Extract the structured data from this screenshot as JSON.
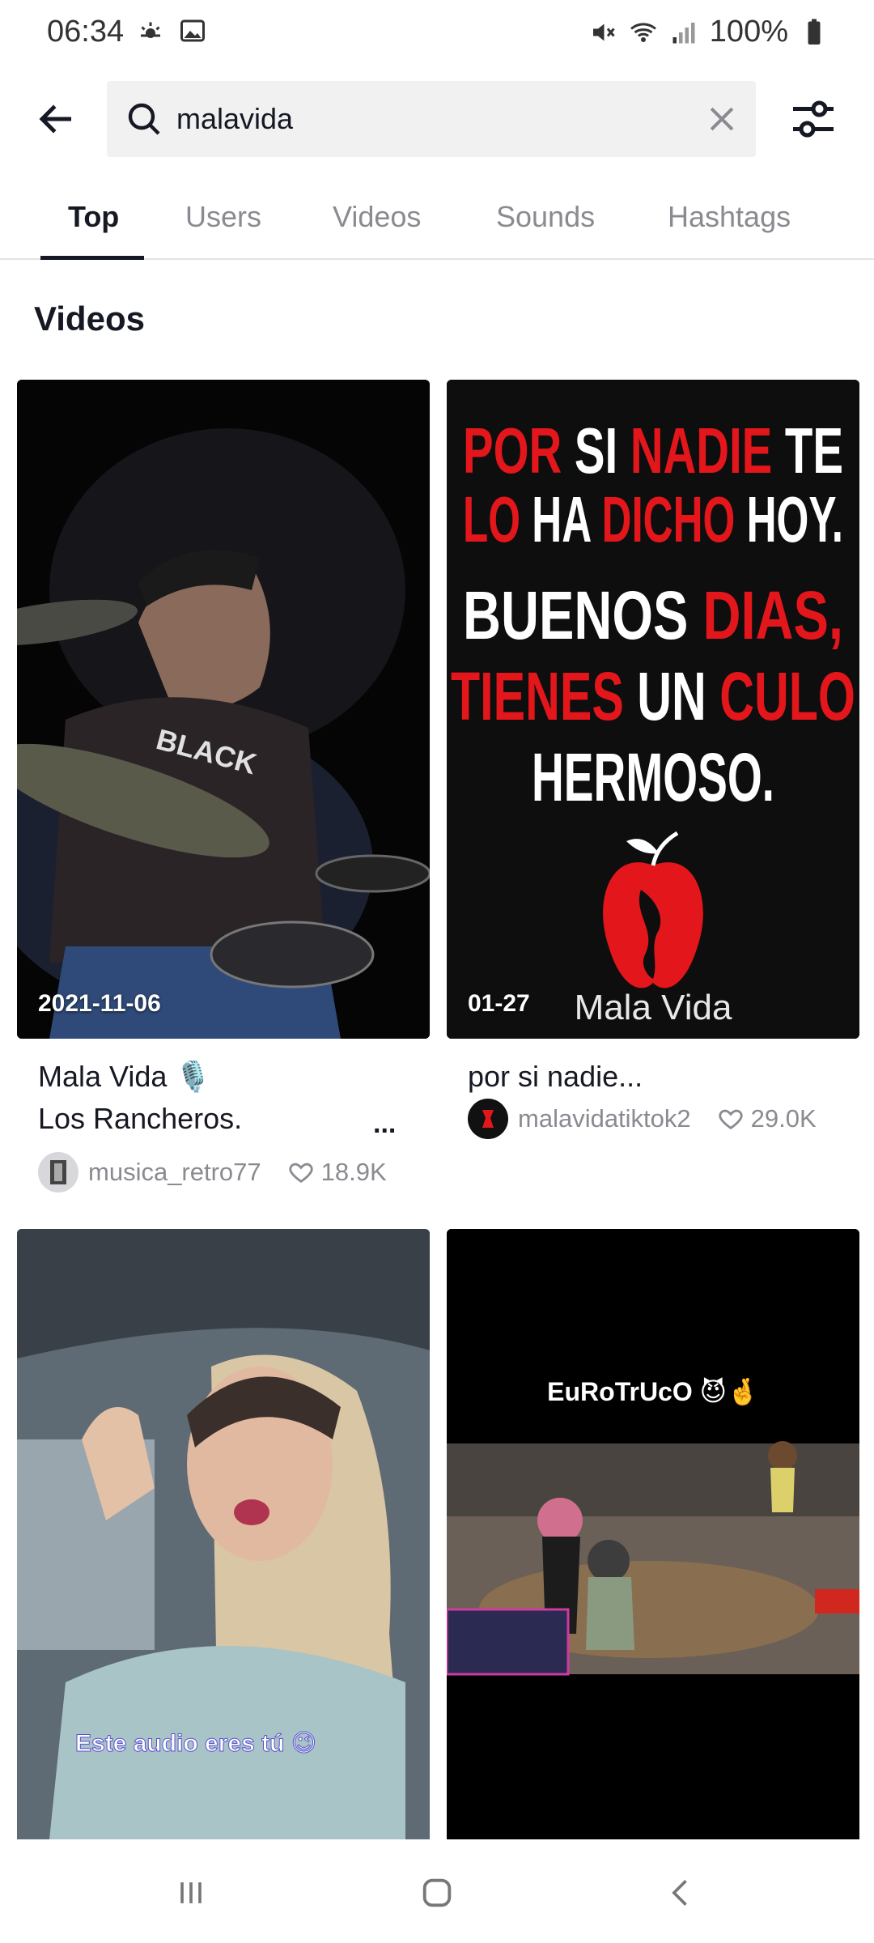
{
  "status_bar": {
    "time": "06:34",
    "battery": "100%",
    "left_icons": [
      "weather-icon",
      "gallery-icon"
    ],
    "right_icons": [
      "mute-icon",
      "wifi-icon",
      "signal-icon",
      "battery-icon"
    ]
  },
  "search": {
    "query": "malavida",
    "back_icon": "back-arrow-icon",
    "clear_icon": "clear-icon",
    "filter_icon": "filter-icon"
  },
  "tabs": [
    {
      "label": "Top",
      "active": true
    },
    {
      "label": "Users",
      "active": false
    },
    {
      "label": "Videos",
      "active": false
    },
    {
      "label": "Sounds",
      "active": false
    },
    {
      "label": "Hashtags",
      "active": false
    }
  ],
  "section": {
    "title": "Videos"
  },
  "videos": [
    {
      "date": "2021-11-06",
      "title_line1": "Mala Vida 🎙️",
      "title_line2": "Los Rancheros.",
      "more": "...",
      "author": "musica_retro77",
      "likes": "18.9K",
      "thumb_text": "BLACK"
    },
    {
      "date": "01-27",
      "title_line1": "por si nadie...",
      "author": "malavidatiktok2",
      "likes": "29.0K",
      "thumb_lines": [
        {
          "words": [
            {
              "t": "POR ",
              "c": "#e3161b"
            },
            {
              "t": "SI ",
              "c": "#ffffff"
            },
            {
              "t": "NADIE ",
              "c": "#e3161b"
            },
            {
              "t": "TE",
              "c": "#ffffff"
            }
          ]
        },
        {
          "words": [
            {
              "t": "LO ",
              "c": "#e3161b"
            },
            {
              "t": "HA ",
              "c": "#ffffff"
            },
            {
              "t": "DICHO ",
              "c": "#e3161b"
            },
            {
              "t": "HOY.",
              "c": "#ffffff"
            }
          ]
        },
        {
          "words": [
            {
              "t": "BUENOS ",
              "c": "#ffffff"
            },
            {
              "t": "DIAS,",
              "c": "#e3161b"
            }
          ]
        },
        {
          "words": [
            {
              "t": "TIENES ",
              "c": "#e3161b"
            },
            {
              "t": "UN ",
              "c": "#ffffff"
            },
            {
              "t": "CULO",
              "c": "#e3161b"
            }
          ]
        },
        {
          "words": [
            {
              "t": "HERMOSO.",
              "c": "#ffffff"
            }
          ]
        }
      ],
      "brand": "Mala Vida"
    },
    {
      "caption": "Este audio eres tú 😉"
    },
    {
      "overlay_title": "EuRoTrUcO 😈🤞"
    }
  ],
  "colors": {
    "accent_red": "#e3161b",
    "text_primary": "#161823",
    "text_secondary": "#8a8b91"
  },
  "bottom_nav": {
    "recents_icon": "recent-apps-icon",
    "home_icon": "home-icon",
    "back_icon": "nav-back-icon"
  }
}
